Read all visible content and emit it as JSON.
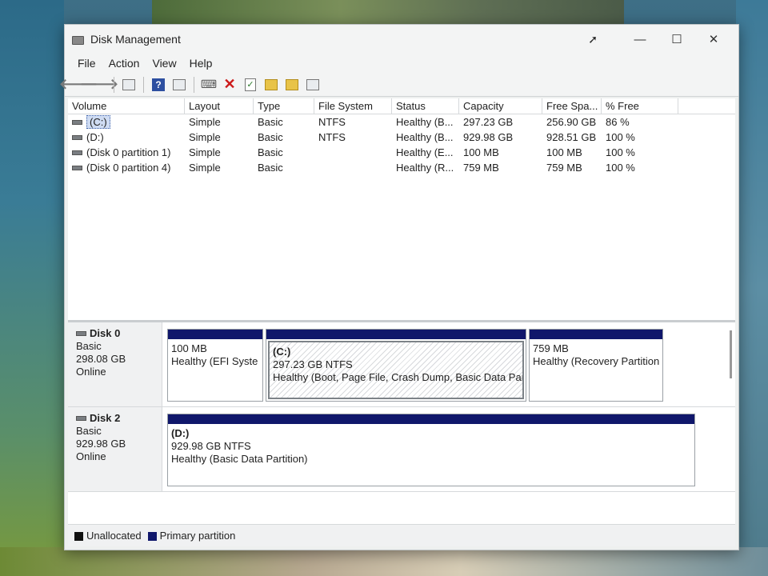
{
  "window": {
    "title": "Disk Management"
  },
  "menu": [
    "File",
    "Action",
    "View",
    "Help"
  ],
  "toolbar": {
    "icons": [
      "back-arrow-icon",
      "forward-arrow-icon",
      "console-tree-icon",
      "help-icon",
      "properties-icon",
      "connect-icon",
      "delete-icon",
      "check-icon",
      "folder-icon",
      "search-folder-icon",
      "list-view-icon"
    ]
  },
  "volume_list": {
    "headers": [
      "Volume",
      "Layout",
      "Type",
      "File System",
      "Status",
      "Capacity",
      "Free Spa...",
      "% Free"
    ],
    "rows": [
      {
        "volume": "(C:)",
        "layout": "Simple",
        "type": "Basic",
        "fs": "NTFS",
        "status": "Healthy (B...",
        "capacity": "297.23 GB",
        "free": "256.90 GB",
        "pct": "86 %"
      },
      {
        "volume": "(D:)",
        "layout": "Simple",
        "type": "Basic",
        "fs": "NTFS",
        "status": "Healthy (B...",
        "capacity": "929.98 GB",
        "free": "928.51 GB",
        "pct": "100 %"
      },
      {
        "volume": "(Disk 0 partition 1)",
        "layout": "Simple",
        "type": "Basic",
        "fs": "",
        "status": "Healthy (E...",
        "capacity": "100 MB",
        "free": "100 MB",
        "pct": "100 %"
      },
      {
        "volume": "(Disk 0 partition 4)",
        "layout": "Simple",
        "type": "Basic",
        "fs": "",
        "status": "Healthy (R...",
        "capacity": "759 MB",
        "free": "759 MB",
        "pct": "100 %"
      }
    ]
  },
  "disks": [
    {
      "name": "Disk 0",
      "type": "Basic",
      "size": "298.08 GB",
      "state": "Online",
      "partitions": [
        {
          "title": "",
          "size": "100 MB",
          "status": "Healthy (EFI Syste"
        },
        {
          "title": "(C:)",
          "size": "297.23 GB NTFS",
          "status": "Healthy (Boot, Page File, Crash Dump, Basic Data Partit"
        },
        {
          "title": "",
          "size": "759 MB",
          "status": "Healthy (Recovery Partition"
        }
      ]
    },
    {
      "name": "Disk 2",
      "type": "Basic",
      "size": "929.98 GB",
      "state": "Online",
      "partitions": [
        {
          "title": "(D:)",
          "size": "929.98 GB NTFS",
          "status": "Healthy (Basic Data Partition)"
        }
      ]
    }
  ],
  "legend": [
    {
      "label": "Unallocated",
      "color": "#111111"
    },
    {
      "label": "Primary partition",
      "color": "#10176b"
    }
  ]
}
